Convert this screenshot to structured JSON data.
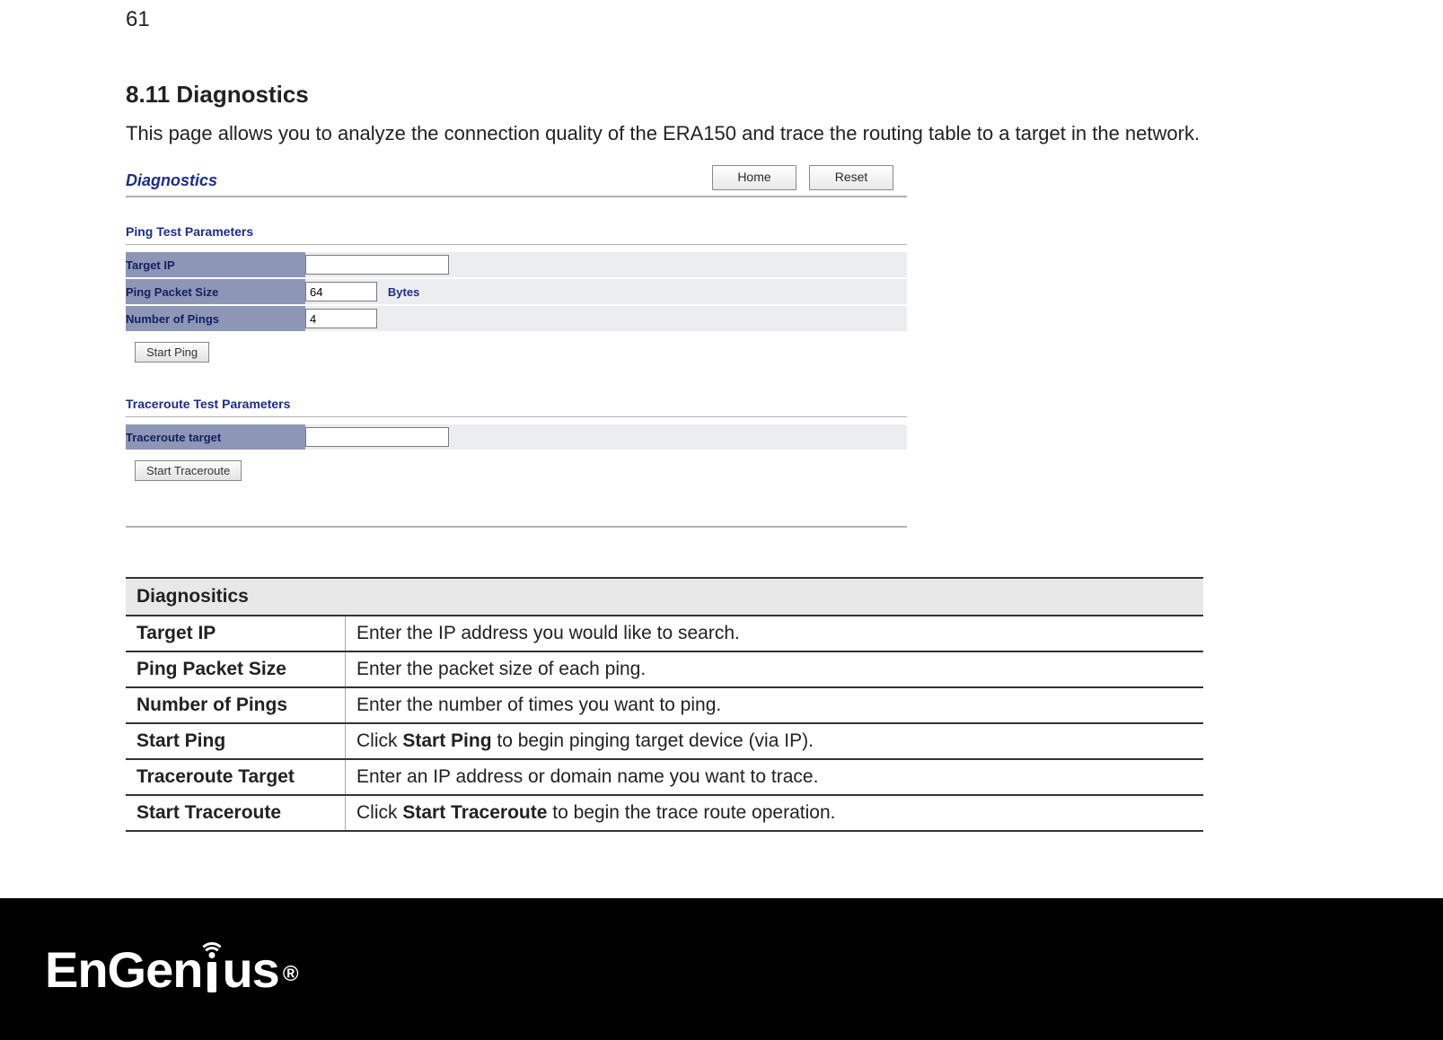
{
  "page_number": "61",
  "heading": "8.11 Diagnostics",
  "intro": "This page allows you to analyze the connection quality of the ERA150 and trace the routing table to a target in the network.",
  "ui": {
    "title": "Diagnostics",
    "home_btn": "Home",
    "reset_btn": "Reset",
    "ping_section": "Ping Test Parameters",
    "target_ip_label": "Target IP",
    "target_ip_value": "",
    "packet_size_label": "Ping Packet Size",
    "packet_size_value": "64",
    "packet_size_unit": "Bytes",
    "num_pings_label": "Number of Pings",
    "num_pings_value": "4",
    "start_ping_btn": "Start Ping",
    "trace_section": "Traceroute Test Parameters",
    "trace_target_label": "Traceroute target",
    "trace_target_value": "",
    "start_trace_btn": "Start Traceroute"
  },
  "desc": {
    "header": "Diagnositics",
    "rows": [
      {
        "term": "Target IP",
        "text_before": "Enter the IP address you would like to search.",
        "bold": "",
        "text_after": ""
      },
      {
        "term": "Ping Packet Size",
        "text_before": "Enter the packet size of each ping.",
        "bold": "",
        "text_after": ""
      },
      {
        "term": "Number of Pings",
        "text_before": "Enter the number of times you want to ping.",
        "bold": "",
        "text_after": ""
      },
      {
        "term": "Start Ping",
        "text_before": "Click ",
        "bold": "Start Ping",
        "text_after": " to begin pinging target device (via IP)."
      },
      {
        "term": "Traceroute Target",
        "text_before": "Enter an IP address or domain name you want to trace.",
        "bold": "",
        "text_after": ""
      },
      {
        "term": "Start Traceroute",
        "text_before": "Click ",
        "bold": "Start Traceroute",
        "text_after": " to begin the trace route operation."
      }
    ]
  },
  "brand": {
    "part1": "EnGen",
    "part2": "us",
    "reg": "®"
  }
}
